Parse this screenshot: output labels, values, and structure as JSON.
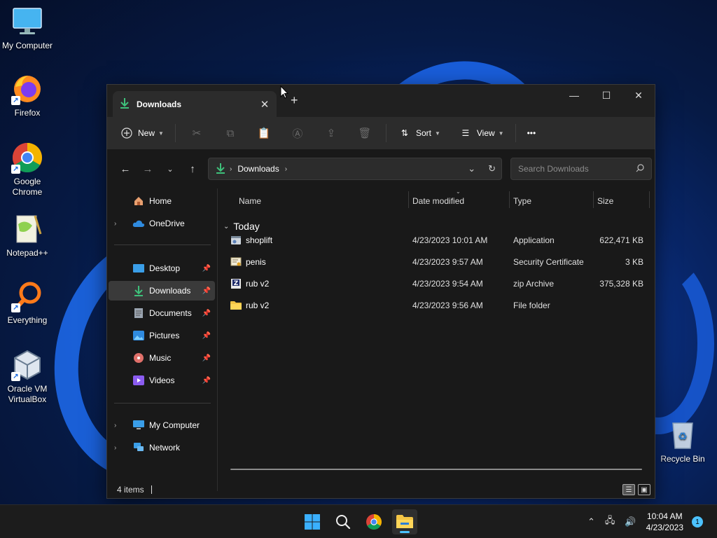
{
  "desktop": {
    "icons": [
      {
        "label": "My Computer"
      },
      {
        "label": "Firefox"
      },
      {
        "label": "Google Chrome"
      },
      {
        "label": "Notepad++"
      },
      {
        "label": "Everything"
      },
      {
        "label": "Oracle VM VirtualBox"
      },
      {
        "label": "Recycle Bin"
      }
    ],
    "shortcut_badge": "↗"
  },
  "window": {
    "tab_title": "Downloads",
    "tab_close": "✕",
    "new_tab": "+",
    "controls": {
      "minimize": "—",
      "maximize": "☐",
      "close": "✕"
    },
    "command_bar": {
      "new_label": "New",
      "sort_label": "Sort",
      "view_label": "View",
      "more": "•••"
    },
    "address": {
      "crumb": "Downloads",
      "search_placeholder": "Search Downloads"
    },
    "nav": {
      "items": [
        {
          "label": "Home"
        },
        {
          "label": "OneDrive"
        },
        {
          "label": "Desktop"
        },
        {
          "label": "Downloads"
        },
        {
          "label": "Documents"
        },
        {
          "label": "Pictures"
        },
        {
          "label": "Music"
        },
        {
          "label": "Videos"
        },
        {
          "label": "My Computer"
        },
        {
          "label": "Network"
        }
      ]
    },
    "columns": {
      "name": "Name",
      "date": "Date modified",
      "type": "Type",
      "size": "Size"
    },
    "group": "Today",
    "files": [
      {
        "name": "shoplift",
        "date": "4/23/2023 10:01 AM",
        "type": "Application",
        "size": "622,471 KB"
      },
      {
        "name": "penis",
        "date": "4/23/2023 9:57 AM",
        "type": "Security Certificate",
        "size": "3 KB"
      },
      {
        "name": "rub v2",
        "date": "4/23/2023 9:54 AM",
        "type": "zip Archive",
        "size": "375,328 KB"
      },
      {
        "name": "rub v2",
        "date": "4/23/2023 9:56 AM",
        "type": "File folder",
        "size": ""
      }
    ],
    "status": "4 items"
  },
  "taskbar": {
    "time": "10:04 AM",
    "date": "4/23/2023",
    "notification_count": "1"
  },
  "colors": {
    "accent": "#4cc2ff",
    "download_green": "#3ec07a",
    "folder_yellow": "#f4c545"
  }
}
